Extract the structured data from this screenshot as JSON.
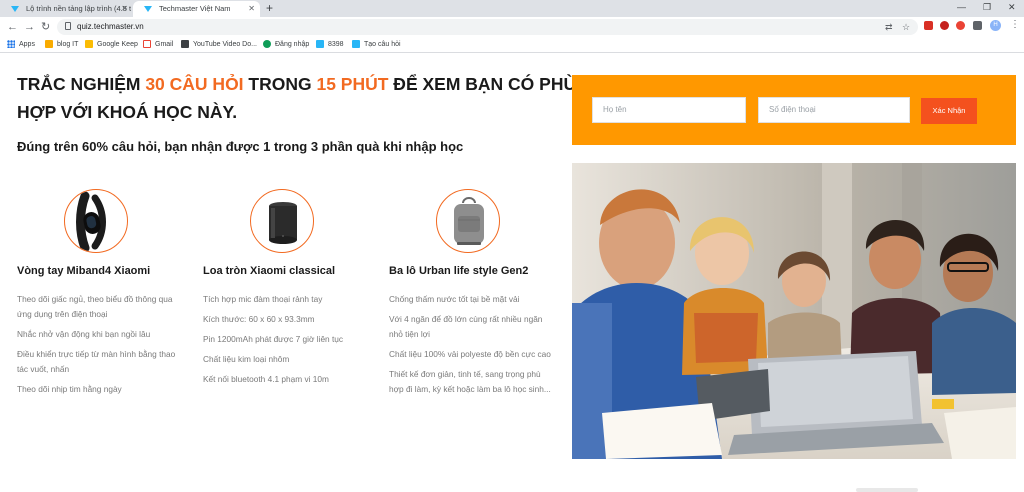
{
  "browser": {
    "tabs": [
      {
        "label": "Lộ trình nền tảng lập trình (4.5 t"
      },
      {
        "label": "Techmaster Việt Nam"
      }
    ],
    "url": "quiz.techmaster.vn",
    "bookmarks": [
      {
        "label": "Apps",
        "icon": "apps-grid-icon",
        "color": "#1a73e8"
      },
      {
        "label": "blog IT",
        "icon": "folder-icon",
        "color": "#f9ab00"
      },
      {
        "label": "Google Keep",
        "icon": "keep-icon",
        "color": "#fbbc04"
      },
      {
        "label": "Gmail",
        "icon": "gmail-icon",
        "color": "#ea4335"
      },
      {
        "label": "YouTube Video Do...",
        "icon": "play-icon",
        "color": "#3c4043"
      },
      {
        "label": "Đăng nhập",
        "icon": "shield-icon",
        "color": "#0f9d58"
      },
      {
        "label": "8398",
        "icon": "techmaster-icon",
        "color": "#29b6f6"
      },
      {
        "label": "Tạo câu hỏi",
        "icon": "techmaster-icon",
        "color": "#29b6f6"
      }
    ]
  },
  "page": {
    "headline": {
      "part1": "Trắc nghiệm ",
      "accent1": "30 câu hỏi",
      "part2": " trong ",
      "accent2": "15 phút",
      "part3": " để xem bạn có phù hợp với khoá học này."
    },
    "subhead": "Đúng trên 60% câu hỏi, bạn nhận được 1 trong 3 phần quà khi nhập học",
    "prizes": [
      {
        "title": "Vòng tay Miband4 Xiaomi",
        "image": "fitness-band",
        "features": [
          "Theo dõi giấc ngủ, theo biểu đồ thông qua ứng dụng trên điện thoại",
          "Nhắc nhở vận động khi bạn ngồi lâu",
          "Điều khiển trực tiếp từ màn hình bằng thao tác vuốt, nhấn",
          "Theo dõi nhịp tim hằng ngày"
        ]
      },
      {
        "title": "Loa tròn Xiaomi classical",
        "image": "cylinder-speaker",
        "features": [
          "Tích hợp mic đàm thoại rảnh tay",
          "Kích thước: 60 x 60 x 93.3mm",
          "Pin 1200mAh phát được 7 giờ liên tục",
          "Chất liệu kim loại nhôm",
          "Kết nối bluetooth 4.1 phạm vi 10m"
        ]
      },
      {
        "title": "Ba lô Urban life style Gen2",
        "image": "backpack",
        "features": [
          "Chống thấm nước tốt tại bề mặt vải",
          "Với 4 ngăn để đồ lớn cùng rất nhiều ngăn nhỏ tiện lợi",
          "Chất liệu 100% vải polyeste độ bền cực cao",
          "Thiết kế đơn giản, tinh tế, sang trọng phù hợp đi làm, kỳ kết hoặc làm ba lô học sinh..."
        ]
      }
    ],
    "form": {
      "name_placeholder": "Họ tên",
      "phone_placeholder": "Số điện thoại",
      "submit_label": "Xác Nhận",
      "background": "#ff9800",
      "button_color": "#f4511e"
    },
    "colors": {
      "accent": "#f26a21"
    },
    "photo": {
      "subject": "students-studying-with-laptop"
    }
  }
}
